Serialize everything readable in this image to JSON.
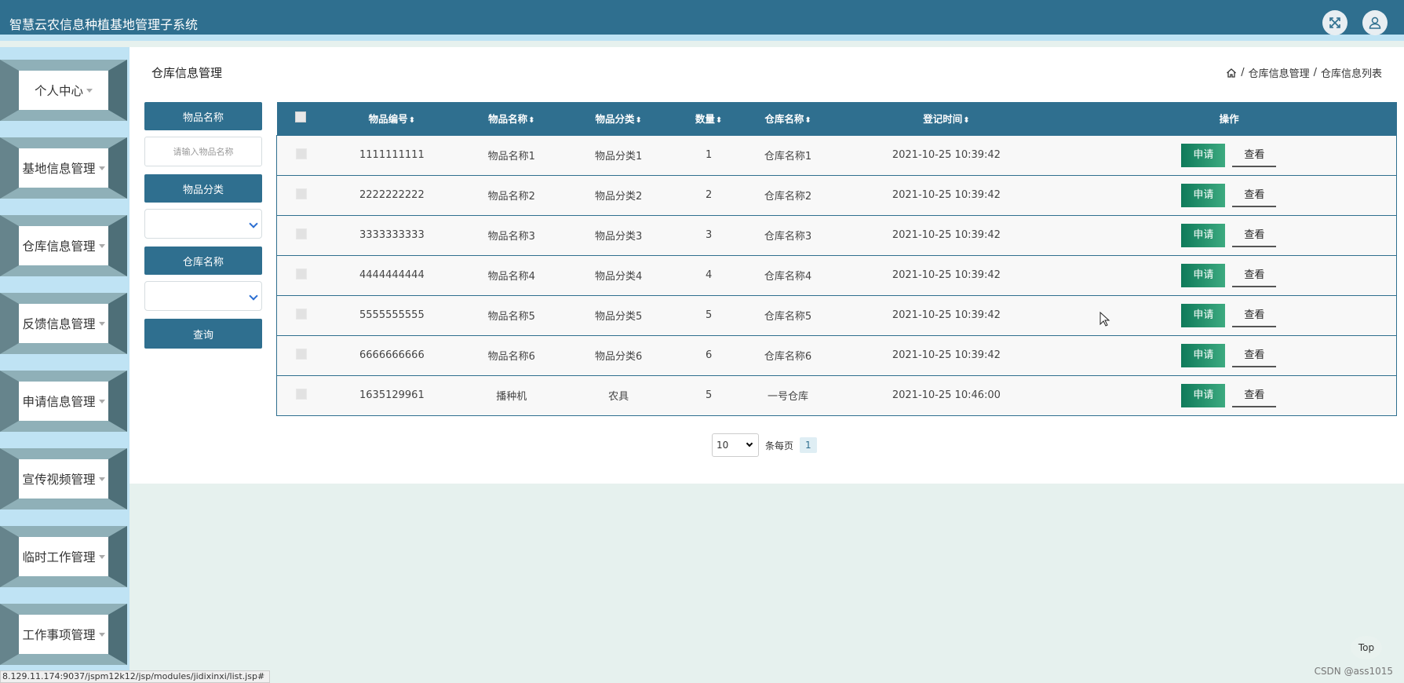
{
  "header": {
    "title": "智慧云农信息种植基地管理子系统",
    "fullscreen_icon": "fullscreen-icon",
    "user_icon": "user-icon"
  },
  "sidebar": {
    "items": [
      {
        "label": "个人中心"
      },
      {
        "label": "基地信息管理"
      },
      {
        "label": "仓库信息管理"
      },
      {
        "label": "反馈信息管理"
      },
      {
        "label": "申请信息管理"
      },
      {
        "label": "宣传视频管理"
      },
      {
        "label": "临时工作管理"
      },
      {
        "label": "工作事项管理"
      }
    ]
  },
  "page": {
    "title": "仓库信息管理",
    "breadcrumb": [
      "仓库信息管理",
      "仓库信息列表"
    ],
    "separator": "/"
  },
  "search": {
    "item_name_label": "物品名称",
    "item_name_placeholder": "请输入物品名称",
    "category_label": "物品分类",
    "warehouse_label": "仓库名称",
    "query_button": "查询"
  },
  "table": {
    "columns": [
      "物品编号",
      "物品名称",
      "物品分类",
      "数量",
      "仓库名称",
      "登记时间",
      "操作"
    ],
    "sort_glyph": "⬍",
    "apply_label": "申请",
    "view_label": "查看",
    "rows": [
      {
        "code": "1111111111",
        "name": "物品名称1",
        "category": "物品分类1",
        "qty": "1",
        "warehouse": "仓库名称1",
        "time": "2021-10-25 10:39:42"
      },
      {
        "code": "2222222222",
        "name": "物品名称2",
        "category": "物品分类2",
        "qty": "2",
        "warehouse": "仓库名称2",
        "time": "2021-10-25 10:39:42"
      },
      {
        "code": "3333333333",
        "name": "物品名称3",
        "category": "物品分类3",
        "qty": "3",
        "warehouse": "仓库名称3",
        "time": "2021-10-25 10:39:42"
      },
      {
        "code": "4444444444",
        "name": "物品名称4",
        "category": "物品分类4",
        "qty": "4",
        "warehouse": "仓库名称4",
        "time": "2021-10-25 10:39:42"
      },
      {
        "code": "5555555555",
        "name": "物品名称5",
        "category": "物品分类5",
        "qty": "5",
        "warehouse": "仓库名称5",
        "time": "2021-10-25 10:39:42"
      },
      {
        "code": "6666666666",
        "name": "物品名称6",
        "category": "物品分类6",
        "qty": "6",
        "warehouse": "仓库名称6",
        "time": "2021-10-25 10:39:42"
      },
      {
        "code": "1635129961",
        "name": "播种机",
        "category": "农具",
        "qty": "5",
        "warehouse": "一号仓库",
        "time": "2021-10-25 10:46:00"
      }
    ]
  },
  "pagination": {
    "page_size": "10",
    "per_page_label": "条每页",
    "current_page": "1"
  },
  "status_bar": {
    "url": "8.129.11.174:9037/jspm12k12/jsp/modules/jidixinxi/list.jsp#"
  },
  "top_label": "Top",
  "watermark": "CSDN @ass1015",
  "colors": {
    "primary": "#2f6f8f",
    "sidebar_bg": "#bfe3f4",
    "apply_button": "#0f7a5a"
  }
}
